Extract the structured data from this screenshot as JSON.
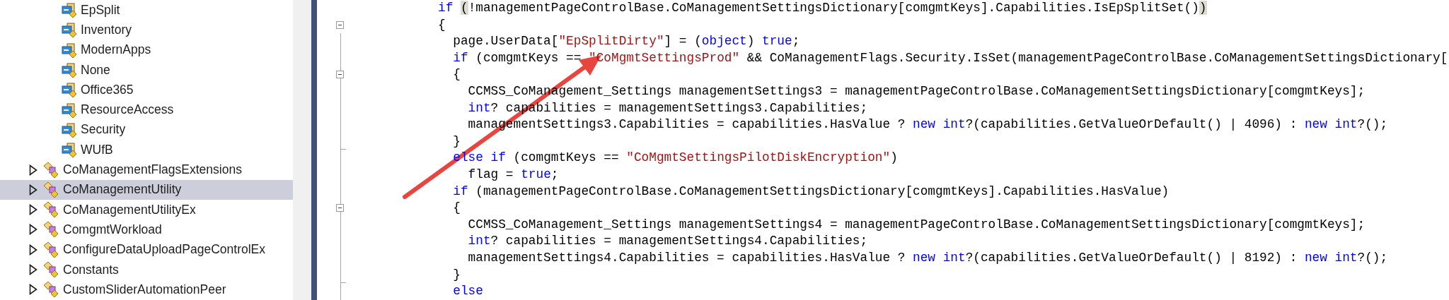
{
  "tree": {
    "members": [
      {
        "label": "EpSplit",
        "selected": false
      },
      {
        "label": "Inventory",
        "selected": false
      },
      {
        "label": "ModernApps",
        "selected": false
      },
      {
        "label": "None",
        "selected": false
      },
      {
        "label": "Office365",
        "selected": false
      },
      {
        "label": "ResourceAccess",
        "selected": false
      },
      {
        "label": "Security",
        "selected": false
      },
      {
        "label": "WUfB",
        "selected": false
      }
    ],
    "classes": [
      {
        "label": "CoManagementFlagsExtensions",
        "expanded": false,
        "selected": false
      },
      {
        "label": "CoManagementUtility",
        "expanded": false,
        "selected": true
      },
      {
        "label": "CoManagementUtilityEx",
        "expanded": false,
        "selected": false
      },
      {
        "label": "ComgmtWorkload",
        "expanded": false,
        "selected": false
      },
      {
        "label": "ConfigureDataUploadPageControlEx",
        "expanded": false,
        "selected": false
      },
      {
        "label": "Constants",
        "expanded": false,
        "selected": false
      },
      {
        "label": "CustomSliderAutomationPeer",
        "expanded": false,
        "selected": false
      }
    ]
  },
  "code": {
    "lines": [
      {
        "collapsible": false,
        "block_end": false,
        "tokens": [
          {
            "kind": "keyword",
            "text": "if "
          },
          {
            "kind": "match",
            "text": "("
          },
          {
            "kind": "plain",
            "text": "!managementPageControlBase.CoManagementSettingsDictionary[comgmtKeys].Capabilities.IsEpSplitSet()"
          },
          {
            "kind": "match",
            "text": ")"
          }
        ]
      },
      {
        "collapsible": true,
        "block_end": false,
        "tokens": [
          {
            "kind": "plain",
            "text": "{"
          }
        ]
      },
      {
        "collapsible": false,
        "block_end": false,
        "tokens": [
          {
            "kind": "plain",
            "text": "  page.UserData["
          },
          {
            "kind": "string",
            "text": "\"EpSplitDirty\""
          },
          {
            "kind": "plain",
            "text": "] = ("
          },
          {
            "kind": "keyword",
            "text": "object"
          },
          {
            "kind": "plain",
            "text": ") "
          },
          {
            "kind": "keyword",
            "text": "true"
          },
          {
            "kind": "plain",
            "text": ";"
          }
        ]
      },
      {
        "collapsible": false,
        "block_end": false,
        "tokens": [
          {
            "kind": "keyword",
            "text": "  if"
          },
          {
            "kind": "plain",
            "text": " (comgmtKeys == "
          },
          {
            "kind": "string",
            "text": "\"CoMgmtSettingsProd\""
          },
          {
            "kind": "plain",
            "text": " && CoManagementFlags.Security.IsSet(managementPageControlBase.CoManagementSettingsDictionary["
          }
        ]
      },
      {
        "collapsible": true,
        "block_end": false,
        "tokens": [
          {
            "kind": "plain",
            "text": "  {"
          }
        ]
      },
      {
        "collapsible": false,
        "block_end": false,
        "tokens": [
          {
            "kind": "plain",
            "text": "    CCMSS_CoManagement_Settings managementSettings3 = managementPageControlBase.CoManagementSettingsDictionary[comgmtKeys];"
          }
        ]
      },
      {
        "collapsible": false,
        "block_end": false,
        "tokens": [
          {
            "kind": "keyword",
            "text": "    int"
          },
          {
            "kind": "plain",
            "text": "? capabilities = managementSettings3.Capabilities;"
          }
        ]
      },
      {
        "collapsible": false,
        "block_end": false,
        "tokens": [
          {
            "kind": "plain",
            "text": "    managementSettings3.Capabilities = capabilities.HasValue ? "
          },
          {
            "kind": "keyword",
            "text": "new int"
          },
          {
            "kind": "plain",
            "text": "?(capabilities.GetValueOrDefault() | 4096) : "
          },
          {
            "kind": "keyword",
            "text": "new int"
          },
          {
            "kind": "plain",
            "text": "?();"
          }
        ]
      },
      {
        "collapsible": false,
        "block_end": true,
        "tokens": [
          {
            "kind": "plain",
            "text": "  }"
          }
        ]
      },
      {
        "collapsible": false,
        "block_end": false,
        "tokens": [
          {
            "kind": "keyword",
            "text": "  else if"
          },
          {
            "kind": "plain",
            "text": " (comgmtKeys == "
          },
          {
            "kind": "string",
            "text": "\"CoMgmtSettingsPilotDiskEncryption\""
          },
          {
            "kind": "plain",
            "text": ")"
          }
        ]
      },
      {
        "collapsible": false,
        "block_end": false,
        "tokens": [
          {
            "kind": "plain",
            "text": "    flag = "
          },
          {
            "kind": "keyword",
            "text": "true"
          },
          {
            "kind": "plain",
            "text": ";"
          }
        ]
      },
      {
        "collapsible": false,
        "block_end": false,
        "tokens": [
          {
            "kind": "keyword",
            "text": "  if"
          },
          {
            "kind": "plain",
            "text": " (managementPageControlBase.CoManagementSettingsDictionary[comgmtKeys].Capabilities.HasValue)"
          }
        ]
      },
      {
        "collapsible": true,
        "block_end": false,
        "tokens": [
          {
            "kind": "plain",
            "text": "  {"
          }
        ]
      },
      {
        "collapsible": false,
        "block_end": false,
        "tokens": [
          {
            "kind": "plain",
            "text": "    CCMSS_CoManagement_Settings managementSettings4 = managementPageControlBase.CoManagementSettingsDictionary[comgmtKeys];"
          }
        ]
      },
      {
        "collapsible": false,
        "block_end": false,
        "tokens": [
          {
            "kind": "keyword",
            "text": "    int"
          },
          {
            "kind": "plain",
            "text": "? capabilities = managementSettings4.Capabilities;"
          }
        ]
      },
      {
        "collapsible": false,
        "block_end": false,
        "tokens": [
          {
            "kind": "plain",
            "text": "    managementSettings4.Capabilities = capabilities.HasValue ? "
          },
          {
            "kind": "keyword",
            "text": "new int"
          },
          {
            "kind": "plain",
            "text": "?(capabilities.GetValueOrDefault() | 8192) : "
          },
          {
            "kind": "keyword",
            "text": "new int"
          },
          {
            "kind": "plain",
            "text": "?();"
          }
        ]
      },
      {
        "collapsible": false,
        "block_end": true,
        "tokens": [
          {
            "kind": "plain",
            "text": "  }"
          }
        ]
      },
      {
        "collapsible": false,
        "block_end": false,
        "tokens": [
          {
            "kind": "keyword",
            "text": "  else"
          }
        ]
      }
    ]
  }
}
